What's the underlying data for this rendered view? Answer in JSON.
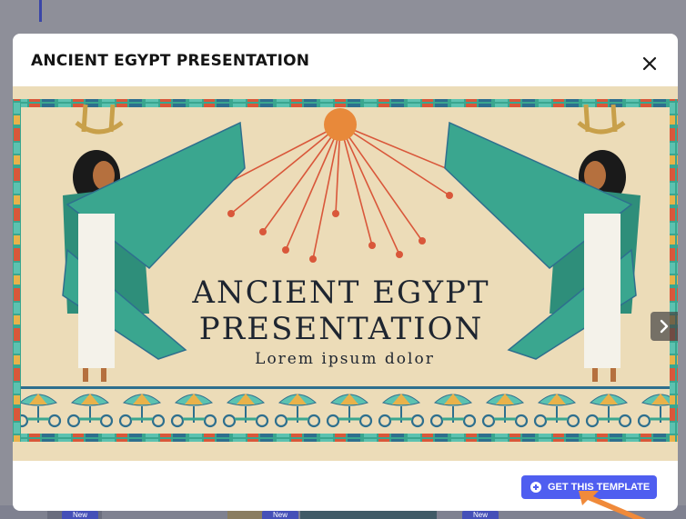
{
  "modal": {
    "title": "ANCIENT EGYPT PRESENTATION",
    "close_icon": "close-icon",
    "cta_label": "GET THIS TEMPLATE",
    "cta_icon": "plus-circle-icon",
    "next_icon": "chevron-right-icon",
    "more_icon": "more-dots-icon",
    "more_label": "•••"
  },
  "slide": {
    "title_line1": "ANCIENT EGYPT",
    "title_line2": "PRESENTATION",
    "subtitle": "Lorem ipsum dolor"
  },
  "background": {
    "badges": [
      "New",
      "New",
      "New"
    ]
  },
  "colors": {
    "accent": "#4f5ef0",
    "parchment": "#ecdcb8",
    "teal": "#3aa68f",
    "sun": "#e8893a"
  }
}
